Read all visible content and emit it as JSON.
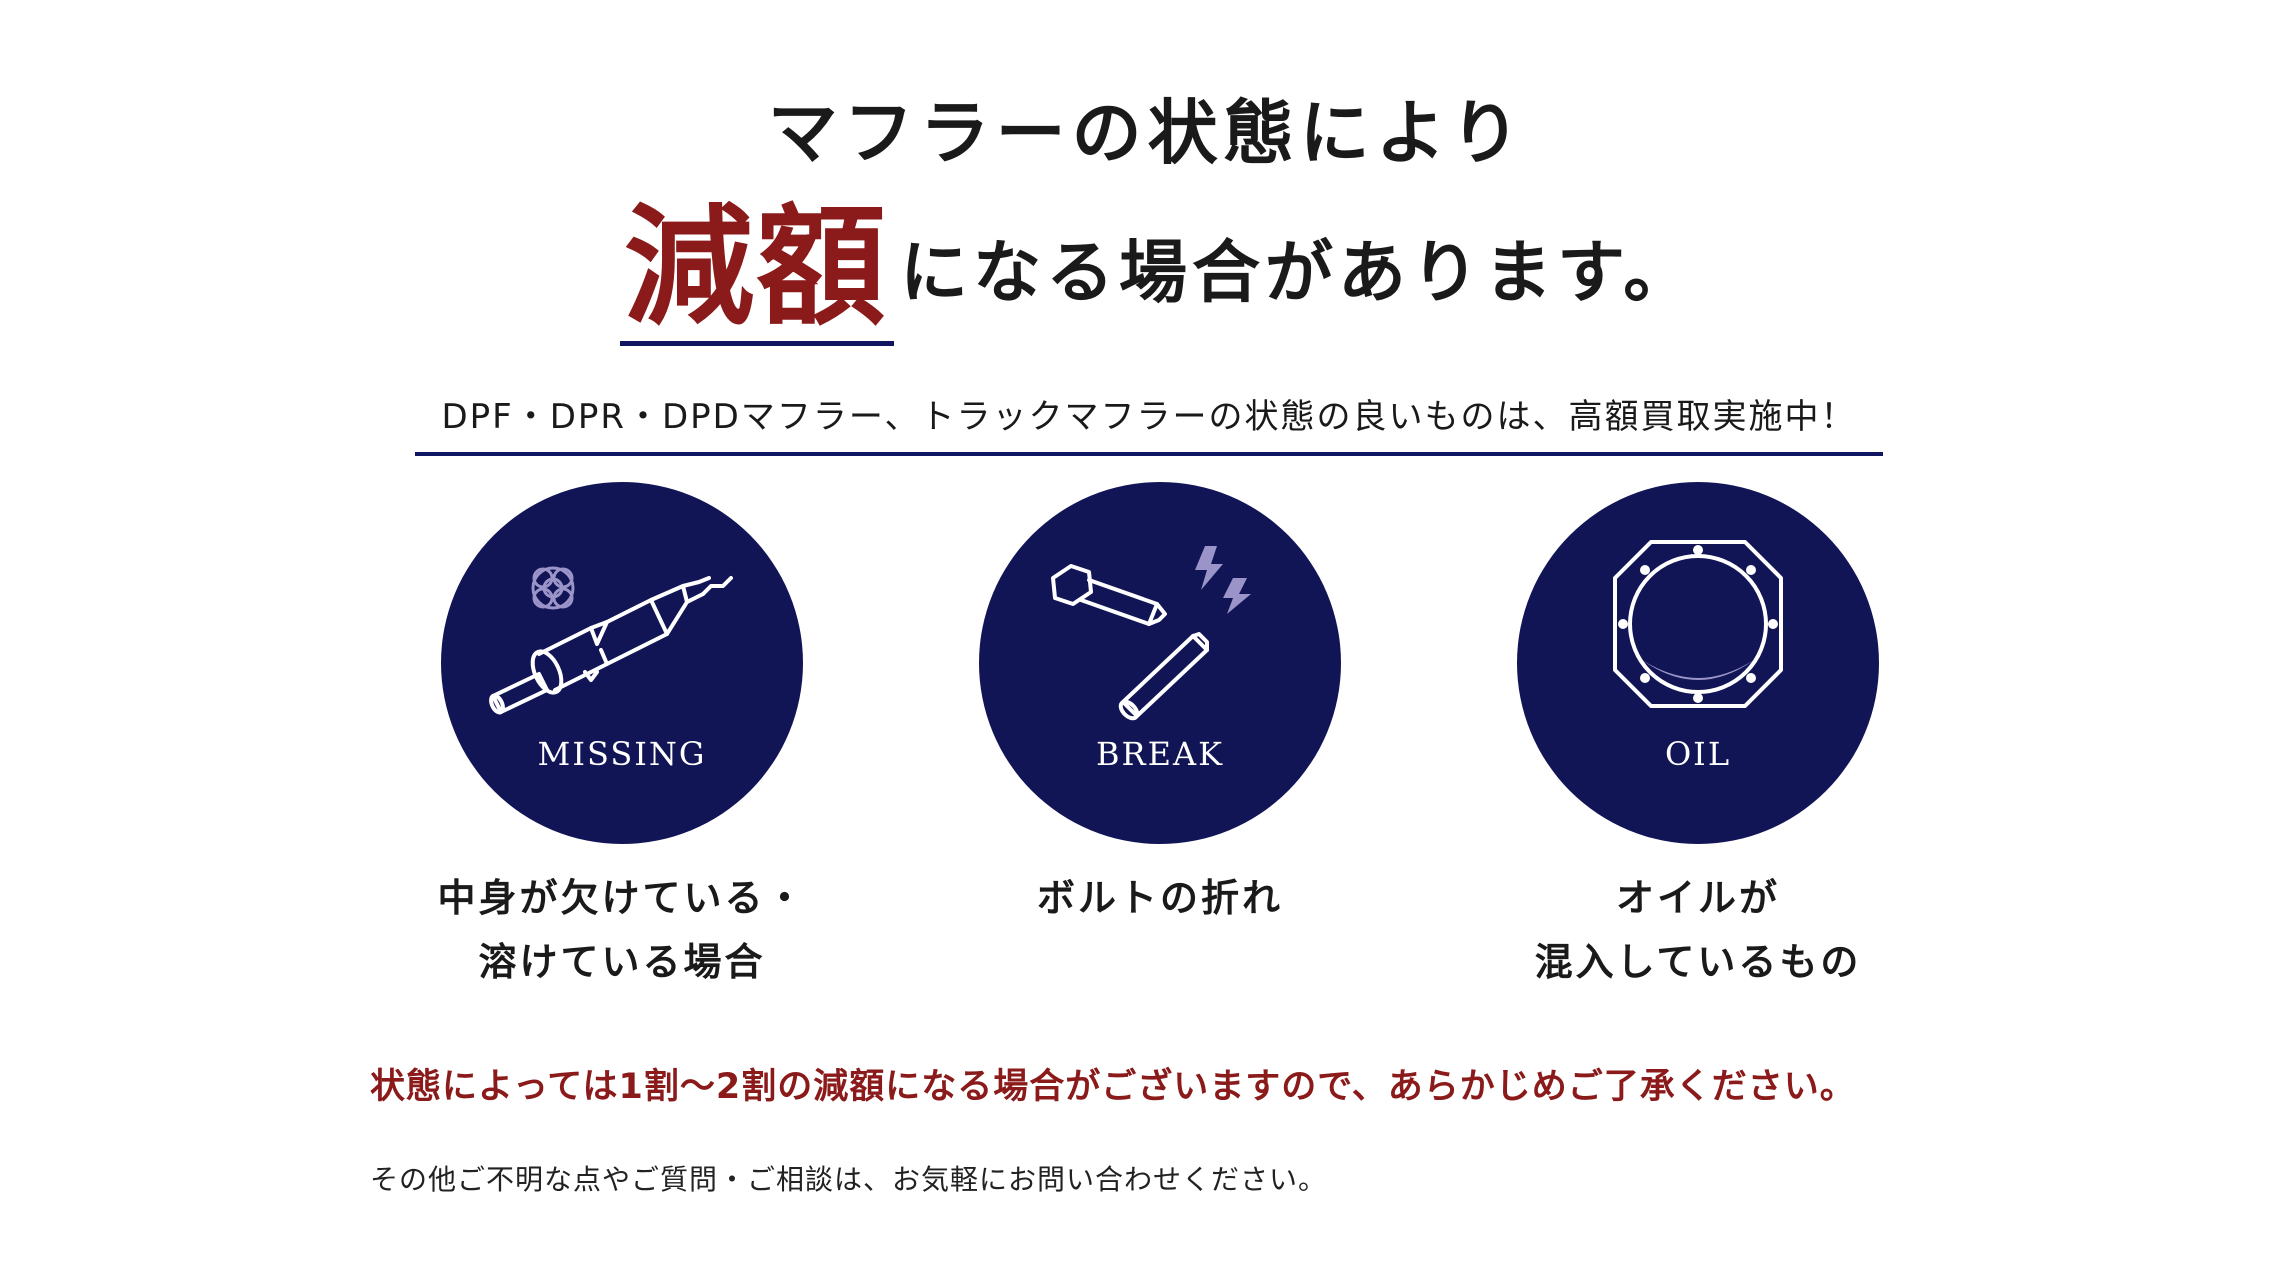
{
  "heading": {
    "line1": "マフラーの状態により",
    "accent": "減額",
    "rest": "になる場合があります。"
  },
  "subheading": "DPF・DPR・DPDマフラー、トラックマフラーの状態の良いものは、高額買取実施中！",
  "conditions": [
    {
      "label": "MISSING",
      "icon": "missing-muffler-icon",
      "caption_line1": "中身が欠けている・",
      "caption_line2": "溶けている場合"
    },
    {
      "label": "BREAK",
      "icon": "broken-bolt-icon",
      "caption_line1": "ボルトの折れ",
      "caption_line2": ""
    },
    {
      "label": "OIL",
      "icon": "oil-flange-icon",
      "caption_line1": "オイルが",
      "caption_line2": "混入しているもの"
    }
  ],
  "notice": "状態によっては1割〜2割の減額になる場合がございますので、あらかじめご了承ください。",
  "footnote": "その他ご不明な点やご質問・ご相談は、お気軽にお問い合わせください。",
  "colors": {
    "navy": "#111556",
    "accent_red": "#8b1a1a",
    "underline_navy": "#0f1560"
  }
}
